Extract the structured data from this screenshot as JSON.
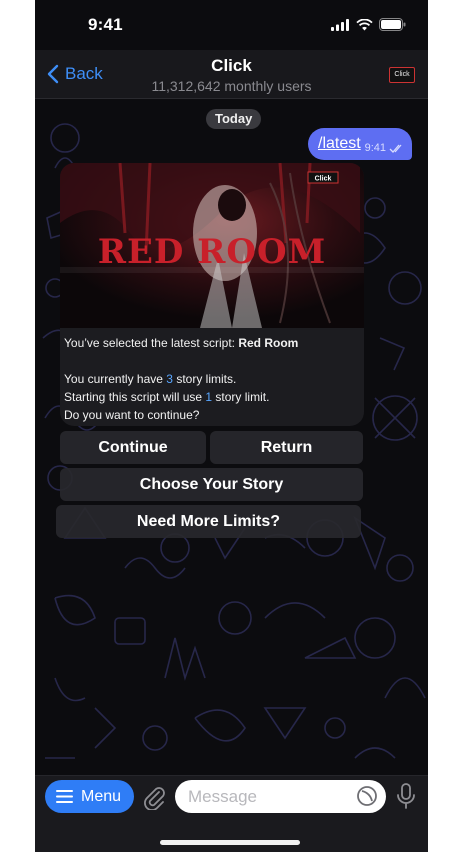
{
  "status_bar": {
    "time": "9:41"
  },
  "header": {
    "back_label": "Back",
    "title": "Click",
    "subtitle": "11,312,642 monthly users",
    "avatar_text": "Click"
  },
  "chat": {
    "date_label": "Today",
    "outgoing": {
      "text": "/latest",
      "time": "9:41"
    },
    "bot_message": {
      "image_logo": "Click",
      "image_title": "RED ROOM",
      "line1_prefix": "You’ve selected the latest script: ",
      "line1_script": "Red Room",
      "line2_prefix": "You currently have ",
      "line2_count": "3",
      "line2_suffix": " story limits.",
      "line3_prefix": "Starting this script will use ",
      "line3_count": "1",
      "line3_suffix": " story limit.",
      "line4": "Do you want to continue?"
    },
    "keyboard": {
      "continue": "Continue",
      "return": "Return",
      "choose_story": "Choose Your Story",
      "need_limits": "Need More Limits?"
    }
  },
  "input_bar": {
    "menu_label": "Menu",
    "placeholder": "Message"
  },
  "colors": {
    "accent": "#2f7df6",
    "outgoing_bubble": "#5e6ef2",
    "highlight": "#58a6ff",
    "background": "#0c0c0f"
  },
  "icons": [
    "signal-icon",
    "wifi-icon",
    "battery-icon",
    "chevron-left-icon",
    "double-check-icon",
    "menu-lines-icon",
    "paperclip-icon",
    "sticker-icon",
    "microphone-icon"
  ]
}
